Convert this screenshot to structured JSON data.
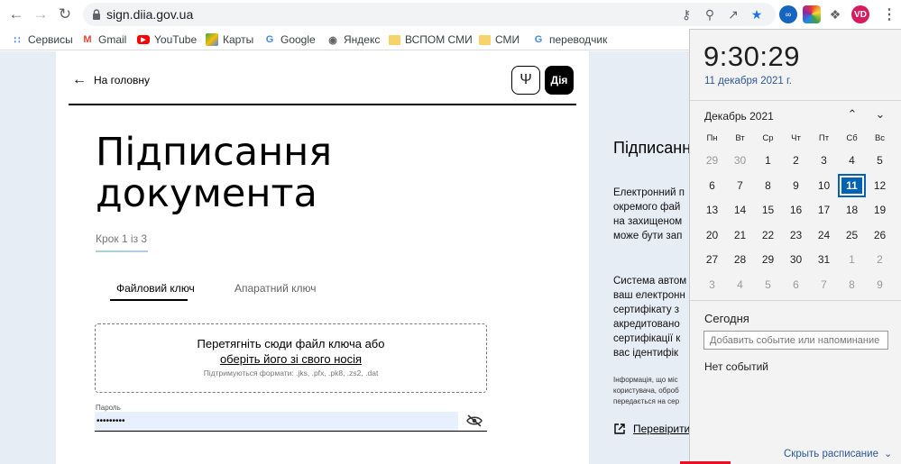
{
  "browser": {
    "url": "sign.diia.gov.ua",
    "profile_initials": "VD"
  },
  "bookmarks": [
    {
      "label": "Сервисы",
      "icon": "apps-grid-icon"
    },
    {
      "label": "Gmail",
      "icon": "gmail-icon"
    },
    {
      "label": "YouTube",
      "icon": "youtube-icon"
    },
    {
      "label": "Карты",
      "icon": "maps-icon"
    },
    {
      "label": "Google",
      "icon": "google-icon"
    },
    {
      "label": "Яндекс",
      "icon": "globe-icon"
    },
    {
      "label": "ВСПОМ СМИ",
      "icon": "folder-icon"
    },
    {
      "label": "СМИ",
      "icon": "folder-icon"
    },
    {
      "label": "переводчик",
      "icon": "google-icon"
    }
  ],
  "page": {
    "back_label": "На головну",
    "logo_label": "Дія",
    "title_line1": "Підписання",
    "title_line2": "документа",
    "step": "Крок 1 із 3",
    "tabs": [
      "Файловий ключ",
      "Апаратний ключ"
    ],
    "dropzone": {
      "line1": "Перетягніть сюди файл ключа або",
      "line2": "оберіть його зі свого носія",
      "formats": "Підтримуються формати: .jks, .pfx, .pk8, .zs2, .dat"
    },
    "password_label": "Пароль",
    "password_value": "•••••••••"
  },
  "side": {
    "title": "Підписанн",
    "para1": "Електронний п\nокремого фай\nна захищеном\nможе бути зап",
    "para2": "Система автом\nваш електронн\nсертифікату з\nакредитовано\nсертифікації к\nвас ідентифік",
    "small": "Інформація, що міс\nкористувача, оброб\nпередається на сер",
    "link": "Перевірити"
  },
  "calendar": {
    "time": "9:30:29",
    "date_long": "11 декабря 2021 г.",
    "month": "Декабрь 2021",
    "weekdays": [
      "Пн",
      "Вт",
      "Ср",
      "Чт",
      "Пт",
      "Сб",
      "Вс"
    ],
    "weeks": [
      [
        "29",
        "30",
        "1",
        "2",
        "3",
        "4",
        "5"
      ],
      [
        "6",
        "7",
        "8",
        "9",
        "10",
        "11",
        "12"
      ],
      [
        "13",
        "14",
        "15",
        "16",
        "17",
        "18",
        "19"
      ],
      [
        "20",
        "21",
        "22",
        "23",
        "24",
        "25",
        "26"
      ],
      [
        "27",
        "28",
        "29",
        "30",
        "31",
        "1",
        "2"
      ],
      [
        "3",
        "4",
        "5",
        "6",
        "7",
        "8",
        "9"
      ]
    ],
    "selected_day": "11",
    "today_heading": "Сегодня",
    "event_placeholder": "Добавить событие или напоминание",
    "no_events": "Нет событий",
    "schedule_link": "Скрыть расписание",
    "accent_color": "#0063b1"
  }
}
